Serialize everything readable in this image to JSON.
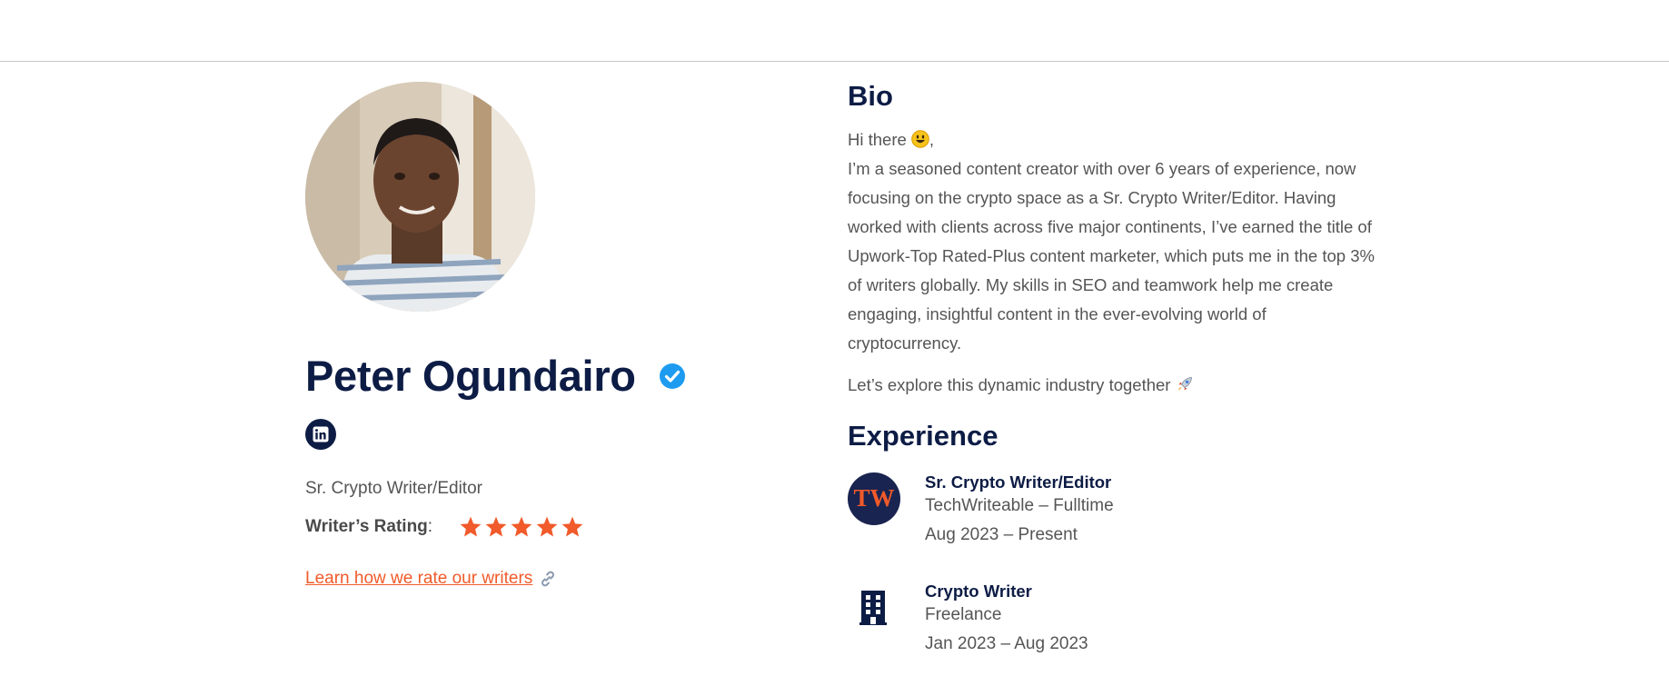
{
  "profile": {
    "name": "Peter Ogundairo",
    "role": "Sr. Crypto Writer/Editor",
    "rating_label": "Writer’s Rating",
    "rating_colon": ":",
    "rating_value": 5,
    "rating_max": 5,
    "learn_link": "Learn how we rate our writers",
    "social": [
      "linkedin-icon"
    ]
  },
  "bio": {
    "title": "Bio",
    "greeting": "Hi there",
    "greeting_suffix": ",",
    "paragraph": "I’m a seasoned content creator with over 6 years of experience, now focusing on the crypto space as a Sr. Crypto Writer/Editor. Having worked with clients across five major continents, I’ve earned the title of Upwork-Top Rated-Plus content marketer, which puts me in the top 3% of writers globally. My skills in SEO and teamwork help me create engaging, insightful content in the ever-evolving world of cryptocurrency.",
    "closing": "Let’s explore this dynamic industry together"
  },
  "experience": {
    "title": "Experience",
    "items": [
      {
        "role": "Sr. Crypto Writer/Editor",
        "company": "TechWriteable – Fulltime",
        "dates": "Aug 2023 – Present",
        "logo_text": "TW",
        "icon": "techwriteable-logo"
      },
      {
        "role": "Crypto Writer",
        "company": "Freelance",
        "dates": "Jan 2023 – Aug 2023",
        "icon": "building-icon"
      }
    ]
  },
  "colors": {
    "navy": "#0d1c45",
    "accent": "#f15a2a",
    "verified": "#1d9bf0",
    "text": "#555555"
  }
}
